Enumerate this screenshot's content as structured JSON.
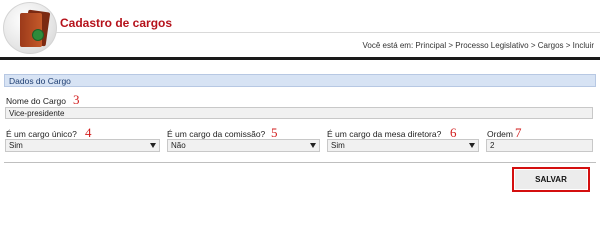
{
  "header": {
    "title": "Cadastro de cargos",
    "logo_icon": "book-icon"
  },
  "breadcrumb": {
    "prefix": "Você está em: ",
    "items": [
      "Principal",
      "Processo Legislativo",
      "Cargos",
      "Incluir"
    ],
    "separator": " > "
  },
  "section": {
    "title": "Dados do Cargo"
  },
  "form": {
    "nome": {
      "label": "Nome do Cargo",
      "value": "Vice-presidente",
      "marker": "3"
    },
    "cargo_unico": {
      "label": "É um cargo único?",
      "value": "Sim",
      "marker": "4"
    },
    "comissao": {
      "label": "É um cargo da comissão?",
      "value": "Não",
      "marker": "5"
    },
    "mesa_diretora": {
      "label": "É um cargo da mesa diretora?",
      "value": "Sim",
      "marker": "6"
    },
    "ordem": {
      "label": "Ordem",
      "value": "2",
      "marker": "7"
    }
  },
  "actions": {
    "save_label": "SALVAR"
  },
  "colors": {
    "title": "#b5121b",
    "section_bg": "#d7e3f4",
    "marker": "#d21d1d",
    "save_border": "#d40f0f"
  }
}
